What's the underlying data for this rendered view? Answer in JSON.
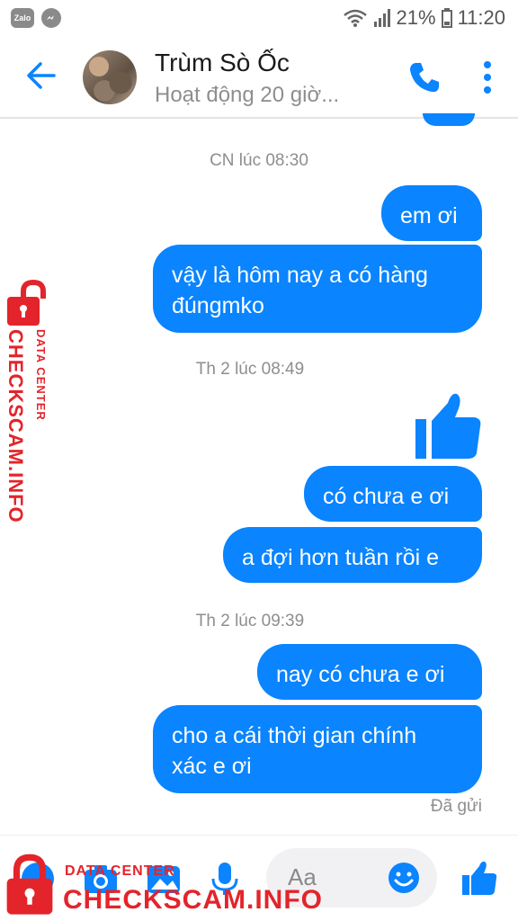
{
  "status_bar": {
    "battery": "21%",
    "time": "11:20",
    "zalo_label": "Zalo"
  },
  "header": {
    "contact_name": "Trùm Sò Ốc",
    "contact_status": "Hoạt động 20 giờ..."
  },
  "conversation": {
    "ts1": "CN lúc 08:30",
    "msg1": "em ơi",
    "msg2_line1": "vậy là hôm nay a có hàng",
    "msg2_line2": "đúngmko",
    "ts2": "Th 2 lúc 08:49",
    "msg4": "có chưa e ơi",
    "msg5": "a đợi hơn tuần rồi e",
    "ts3": "Th 2 lúc 09:39",
    "msg6": "nay có chưa e ơi",
    "msg7_line1": "cho a cái thời gian chính",
    "msg7_line2": "xác e ơi",
    "sent_status": "Đã gửi"
  },
  "composer": {
    "placeholder": "Aa"
  },
  "watermark": {
    "main": "CHECKSCAM.INFO",
    "sub": "DATA CENTER"
  },
  "colors": {
    "accent": "#0a84ff",
    "watermark": "#e3242b"
  },
  "icons": [
    "back-arrow-icon",
    "phone-icon",
    "more-vert-icon",
    "like-icon",
    "camera-icon",
    "gallery-icon",
    "mic-icon",
    "emoji-icon",
    "lock-icon"
  ]
}
